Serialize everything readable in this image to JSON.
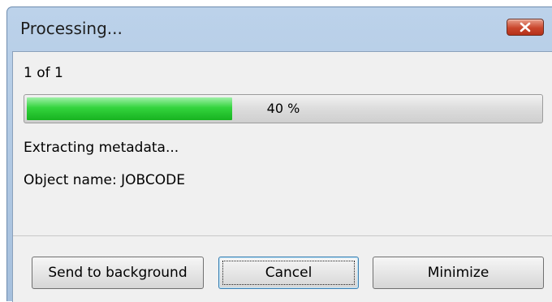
{
  "window": {
    "title": "Processing...",
    "close_icon": "close-x-icon"
  },
  "progress": {
    "counter": "1 of 1",
    "percent": 40,
    "percent_label": "40 %",
    "status": "Extracting metadata...",
    "object_name": "Object name: JOBCODE"
  },
  "buttons": {
    "send_to_background": "Send to background",
    "cancel": "Cancel",
    "minimize": "Minimize"
  },
  "colors": {
    "progress_fill": "#27c832",
    "close_button": "#c9462c"
  }
}
